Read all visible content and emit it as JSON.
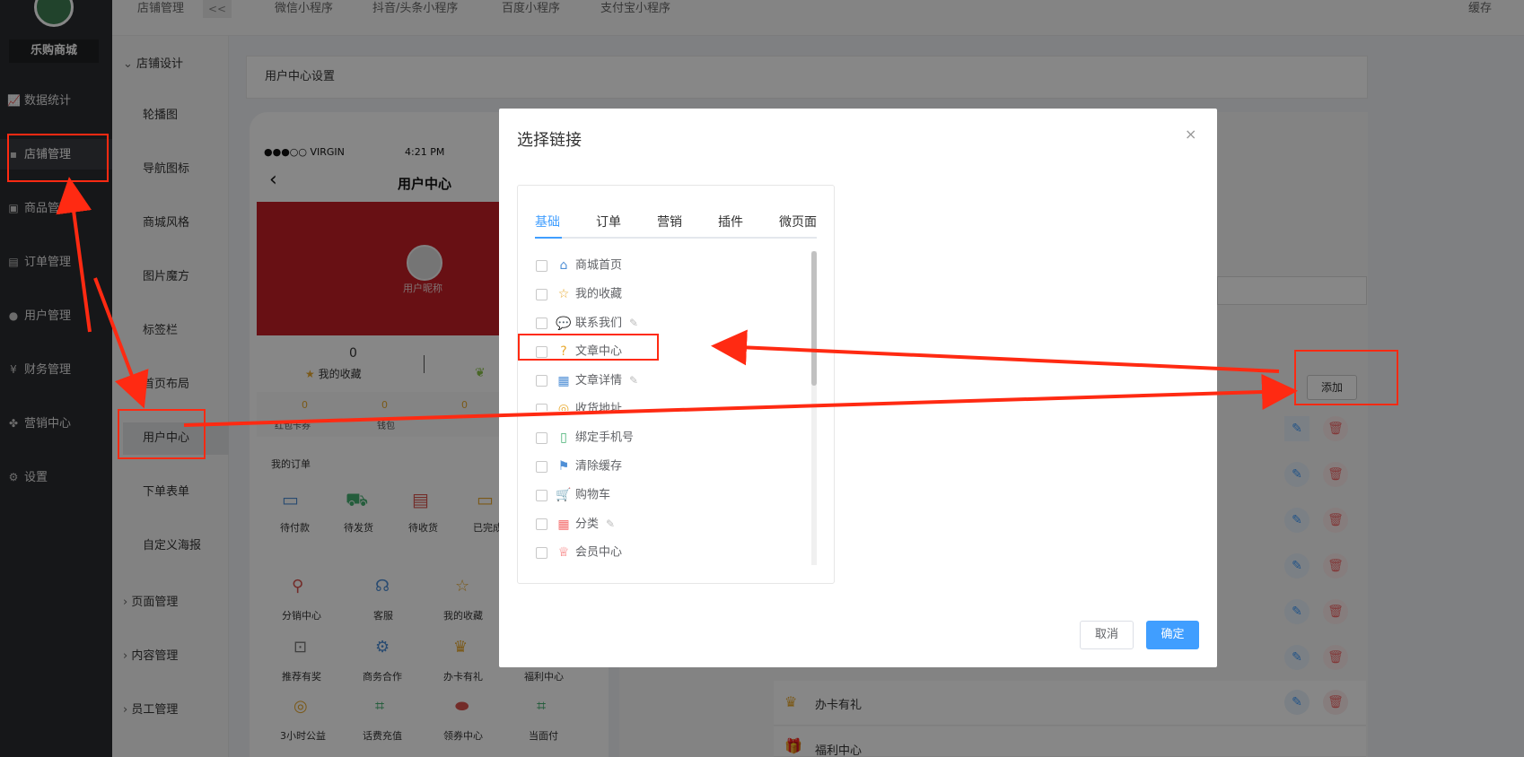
{
  "brand": {
    "name": "乐购商城"
  },
  "topbar": {
    "collapse_label": "<<",
    "tabs": [
      "微信小程序",
      "抖音/头条小程序",
      "百度小程序",
      "支付宝小程序"
    ],
    "cache_label": "缓存"
  },
  "sidebar": {
    "items": [
      {
        "label": "数据统计",
        "icon": "chart-icon"
      },
      {
        "label": "店铺管理",
        "icon": "store-icon"
      },
      {
        "label": "商品管理",
        "icon": "goods-icon"
      },
      {
        "label": "订单管理",
        "icon": "order-icon"
      },
      {
        "label": "用户管理",
        "icon": "user-icon"
      },
      {
        "label": "财务管理",
        "icon": "finance-icon"
      },
      {
        "label": "营销中心",
        "icon": "marketing-icon"
      },
      {
        "label": "设置",
        "icon": "gear-icon"
      }
    ]
  },
  "subnav": {
    "header": "店铺管理",
    "group": "店铺设计",
    "items": [
      "轮播图",
      "导航图标",
      "商城风格",
      "图片魔方",
      "标签栏",
      "首页布局",
      "用户中心",
      "下单表单",
      "自定义海报"
    ],
    "groups": [
      "页面管理",
      "内容管理",
      "员工管理"
    ]
  },
  "breadcrumb": "用户中心设置",
  "phone": {
    "status_carrier": "●●●○○ VIRGIN",
    "status_time": "4:21 PM",
    "title": "用户中心",
    "nickname": "用户昵称",
    "fav_count": "0",
    "fav_label": "我的收藏",
    "wallet": [
      {
        "value": "0",
        "label": "红包卡券"
      },
      {
        "value": "0",
        "label": "钱包"
      },
      {
        "value": "0",
        "label": ""
      }
    ],
    "orders_title": "我的订单",
    "orders": [
      "待付款",
      "待发货",
      "待收货",
      "已完成"
    ],
    "services": [
      "分销中心",
      "客服",
      "我的收藏",
      "推荐有奖",
      "商务合作",
      "办卡有礼",
      "福利中心",
      "3小时公益",
      "话费充值",
      "领券中心",
      "当面付"
    ]
  },
  "right": {
    "add_label": "添加",
    "rows": [
      "办卡有礼",
      "福利中心"
    ]
  },
  "dialog": {
    "title": "选择链接",
    "close": "×",
    "tabs": [
      "基础",
      "订单",
      "营销",
      "插件",
      "微页面"
    ],
    "options": [
      {
        "label": "商城首页",
        "icon": "home-icon",
        "editable": false
      },
      {
        "label": "我的收藏",
        "icon": "star-icon",
        "editable": false
      },
      {
        "label": "联系我们",
        "icon": "chat-icon",
        "editable": true
      },
      {
        "label": "文章中心",
        "icon": "question-icon",
        "editable": false
      },
      {
        "label": "文章详情",
        "icon": "article-icon",
        "editable": true
      },
      {
        "label": "收货地址",
        "icon": "location-icon",
        "editable": false
      },
      {
        "label": "绑定手机号",
        "icon": "phone-icon",
        "editable": false
      },
      {
        "label": "清除缓存",
        "icon": "broom-icon",
        "editable": false
      },
      {
        "label": "购物车",
        "icon": "cart-icon",
        "editable": false
      },
      {
        "label": "分类",
        "icon": "category-icon",
        "editable": true
      },
      {
        "label": "会员中心",
        "icon": "crown-icon",
        "editable": false
      }
    ],
    "cancel_label": "取消",
    "ok_label": "确定"
  },
  "colors": {
    "accent": "#409eff",
    "annotation": "#ff2a12",
    "sidebar": "#2b2c30",
    "banner": "#c41f27"
  }
}
